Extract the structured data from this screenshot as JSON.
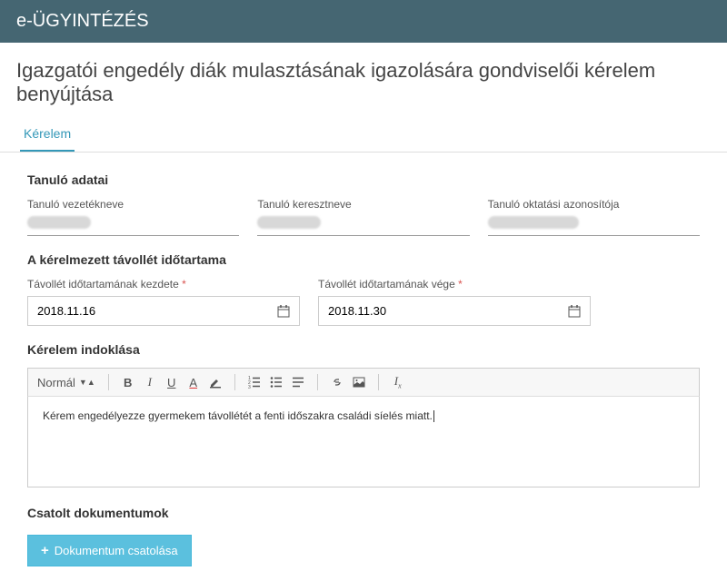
{
  "header": {
    "title": "e-ÜGYINTÉZÉS"
  },
  "page": {
    "title": "Igazgatói engedély diák mulasztásának igazolására gondviselői kérelem benyújtása"
  },
  "tabs": {
    "request": "Kérelem"
  },
  "sections": {
    "student_data": "Tanuló adatai",
    "absence_period": "A kérelmezett távollét időtartama",
    "justification": "Kérelem indoklása",
    "attachments": "Csatolt dokumentumok"
  },
  "fields": {
    "surname_label": "Tanuló vezetékneve",
    "firstname_label": "Tanuló keresztneve",
    "eduid_label": "Tanuló oktatási azonosítója",
    "start_label": "Távollét időtartamának kezdete",
    "end_label": "Távollét időtartamának vége",
    "start_value": "2018.11.16",
    "end_value": "2018.11.30"
  },
  "editor": {
    "format_label": "Normál",
    "body": "Kérem engedélyezze gyermekem távollétét a fenti időszakra családi síelés miatt."
  },
  "buttons": {
    "attach": "Dokumentum csatolása"
  }
}
